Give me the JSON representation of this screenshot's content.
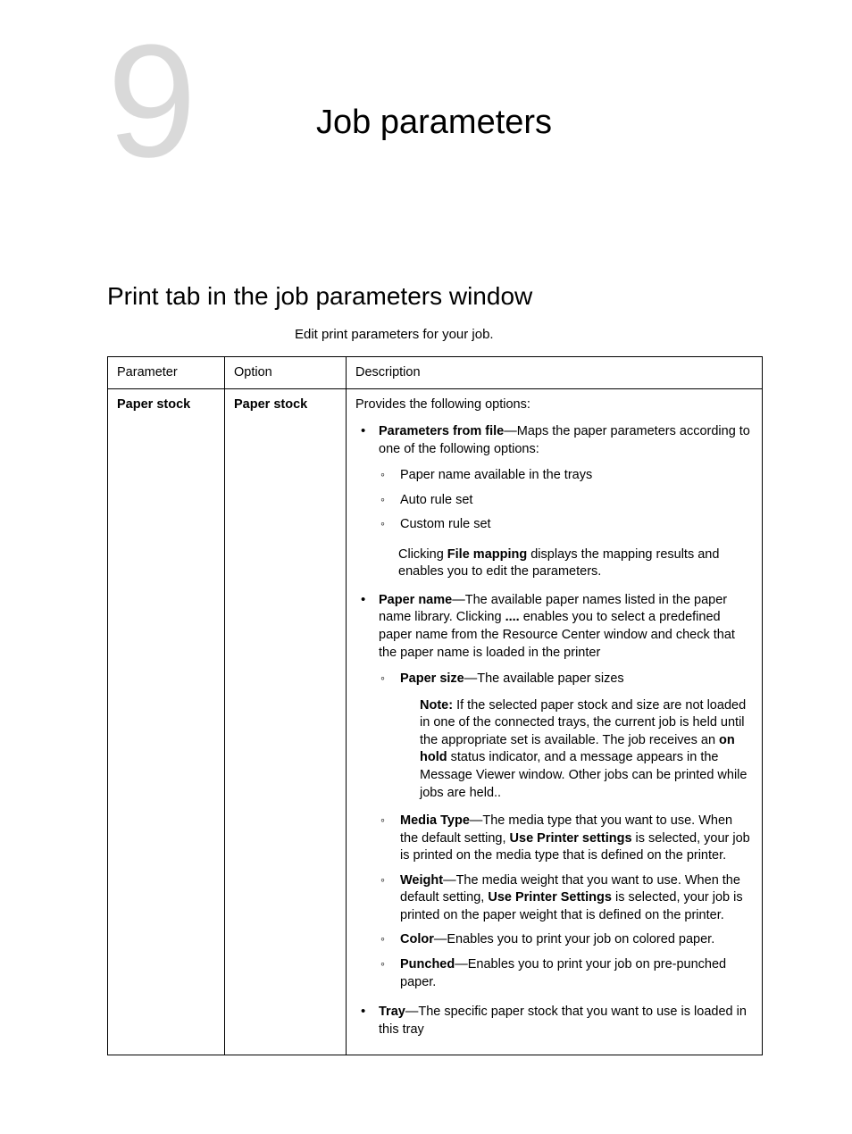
{
  "chapter": {
    "number": "9",
    "title": "Job parameters"
  },
  "section": {
    "title": "Print tab in the job parameters window",
    "subtitle": "Edit print parameters for your job."
  },
  "table": {
    "headers": {
      "parameter": "Parameter",
      "option": "Option",
      "description": "Description"
    },
    "row": {
      "parameter": "Paper stock",
      "option": "Paper stock",
      "intro": "Provides the following options:",
      "items": {
        "params_from_file": {
          "term": "Parameters from file",
          "rest": "—Maps the paper parameters according to one of the following options:",
          "sub": {
            "a": "Paper name available in the trays",
            "b": "Auto rule set",
            "c": "Custom rule set"
          },
          "after_pre": "Clicking ",
          "after_bold": "File mapping",
          "after_post": " displays the mapping results and enables you to edit the parameters."
        },
        "paper_name": {
          "term": "Paper name",
          "rest1": "—The available paper names listed in the paper name library. Clicking ",
          "dots": "....",
          "rest2": " enables you to select a predefined paper name from the Resource Center window and check that the paper name is loaded in the printer",
          "sub": {
            "paper_size": {
              "term": "Paper size",
              "rest": "—The available paper sizes",
              "note_label": "Note:",
              "note_pre": " If the selected paper stock and size are not loaded in one of the connected trays, the current job is held until the appropriate set is available. The job receives an ",
              "note_bold": "on hold",
              "note_post": " status indicator, and a message appears in the Message Viewer window. Other jobs can be printed while jobs are held.."
            },
            "media_type": {
              "term": "Media Type",
              "rest_pre": "—The media type that you want to use. When the default setting, ",
              "rest_bold": "Use Printer settings",
              "rest_post": " is selected, your job is printed on the media type that is defined on the printer."
            },
            "weight": {
              "term": "Weight",
              "rest_pre": "—The media weight that you want to use. When the default setting, ",
              "rest_bold": "Use Printer Settings",
              "rest_post": " is selected, your job is printed on the paper weight that is defined on the printer."
            },
            "color": {
              "term": "Color",
              "rest": "—Enables you to print your job on colored paper."
            },
            "punched": {
              "term": "Punched",
              "rest": "—Enables you to print your job on pre-punched paper."
            }
          }
        },
        "tray": {
          "term": "Tray",
          "rest": "—The specific paper stock that you want to use is loaded in this tray"
        }
      }
    }
  }
}
